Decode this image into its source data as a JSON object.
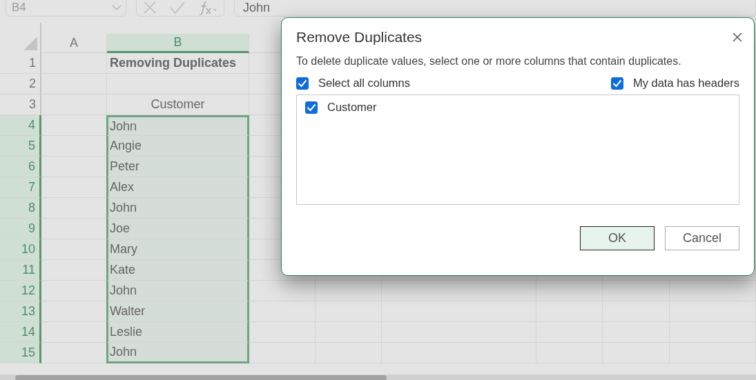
{
  "formula_bar": {
    "name_box": "B4",
    "formula": "John"
  },
  "sheet": {
    "columns": [
      {
        "label": "A",
        "selected": false
      },
      {
        "label": "B",
        "selected": true
      }
    ],
    "rows": [
      {
        "label": "1",
        "selected": false,
        "b": {
          "kind": "title",
          "text": "Removing Duplicates"
        }
      },
      {
        "label": "2",
        "selected": false
      },
      {
        "label": "3",
        "selected": false,
        "b": {
          "kind": "header",
          "text": "Customer"
        }
      },
      {
        "label": "4",
        "selected": true,
        "b": {
          "kind": "value",
          "text": "John"
        }
      },
      {
        "label": "5",
        "selected": true,
        "b": {
          "kind": "value",
          "text": "Angie"
        }
      },
      {
        "label": "6",
        "selected": true,
        "b": {
          "kind": "value",
          "text": "Peter"
        }
      },
      {
        "label": "7",
        "selected": true,
        "b": {
          "kind": "value",
          "text": "Alex"
        }
      },
      {
        "label": "8",
        "selected": true,
        "b": {
          "kind": "value",
          "text": "John"
        }
      },
      {
        "label": "9",
        "selected": true,
        "b": {
          "kind": "value",
          "text": "Joe"
        }
      },
      {
        "label": "10",
        "selected": true,
        "b": {
          "kind": "value",
          "text": "Mary"
        }
      },
      {
        "label": "11",
        "selected": true,
        "b": {
          "kind": "value",
          "text": "Kate"
        }
      },
      {
        "label": "12",
        "selected": true,
        "b": {
          "kind": "value",
          "text": "John"
        }
      },
      {
        "label": "13",
        "selected": true,
        "b": {
          "kind": "value",
          "text": "Walter"
        }
      },
      {
        "label": "14",
        "selected": true,
        "b": {
          "kind": "value",
          "text": "Leslie"
        }
      },
      {
        "label": "15",
        "selected": true,
        "b": {
          "kind": "value",
          "text": "John"
        }
      }
    ]
  },
  "dialog": {
    "title": "Remove Duplicates",
    "description": "To delete duplicate values, select one or more columns that contain duplicates.",
    "select_all": {
      "label": "Select all columns",
      "checked": true
    },
    "has_headers": {
      "label": "My data has headers",
      "checked": true
    },
    "columns": [
      {
        "label": "Customer",
        "checked": true
      }
    ],
    "buttons": [
      {
        "label": "OK",
        "default": true
      },
      {
        "label": "Cancel",
        "default": false
      }
    ]
  }
}
